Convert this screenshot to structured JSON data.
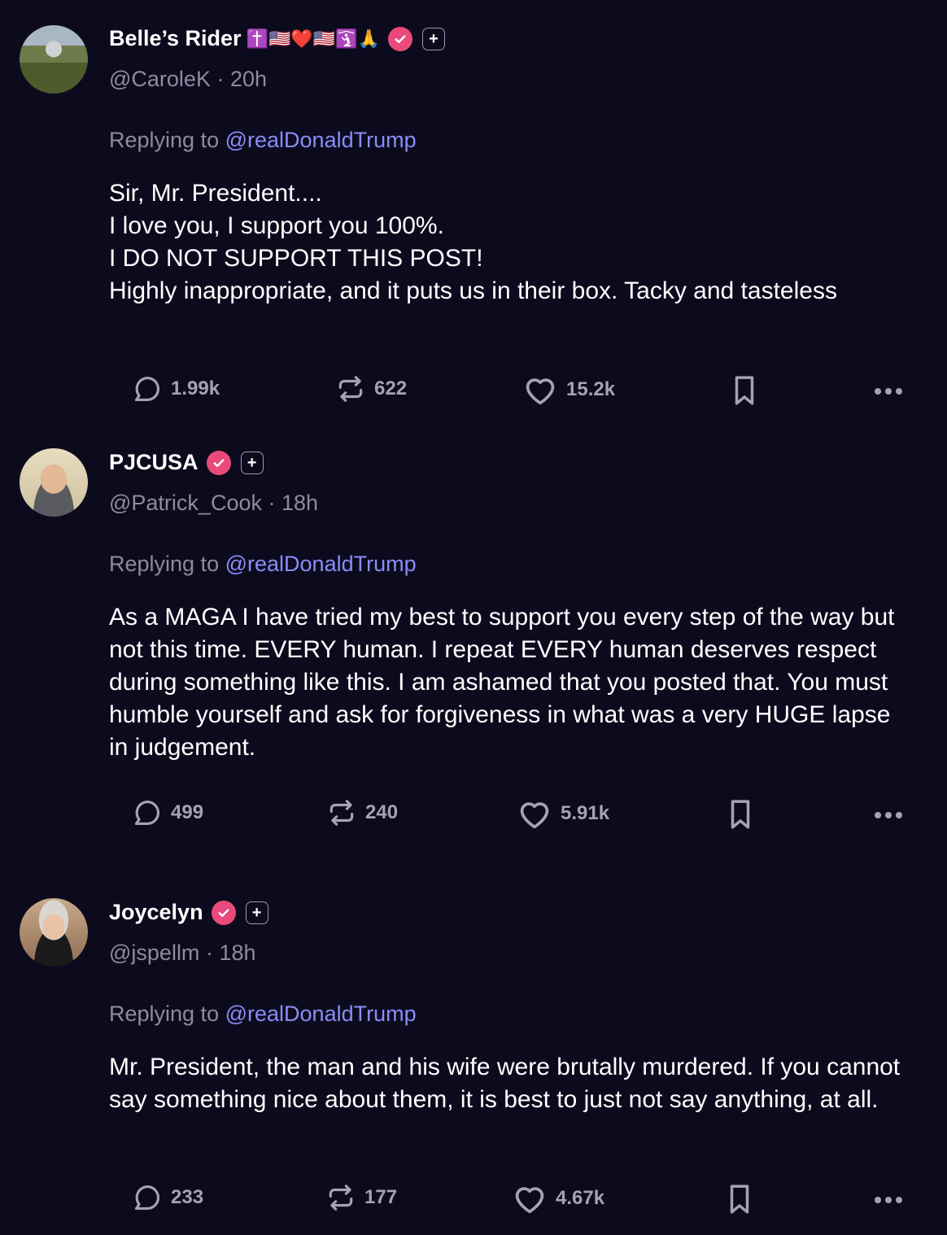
{
  "posts": [
    {
      "name": "Belle’s Rider",
      "emojis": "✝️🇺🇸❤️🇺🇸🛐🙏",
      "handle": "@CaroleK",
      "time": "20h",
      "replying_label": "Replying to",
      "replying_to": "@realDonaldTrump",
      "body": "Sir, Mr. President....\nI love you, I support you 100%.\nI DO NOT SUPPORT THIS POST!\nHighly inappropriate, and it puts us in their box. Tacky and tasteless",
      "replies": "1.99k",
      "reposts": "622",
      "likes": "15.2k"
    },
    {
      "name": "PJCUSA",
      "emojis": "",
      "handle": "@Patrick_Cook",
      "time": "18h",
      "replying_label": "Replying to",
      "replying_to": "@realDonaldTrump",
      "body": "As a MAGA I have tried my best to support you every step of the way but not this time.  EVERY human.  I repeat EVERY human deserves respect during something like this.  I am ashamed that you posted that. You must humble yourself and ask for forgiveness in what was a very HUGE lapse in judgement.",
      "replies": "499",
      "reposts": "240",
      "likes": "5.91k"
    },
    {
      "name": "Joycelyn",
      "emojis": "",
      "handle": "@jspellm",
      "time": "18h",
      "replying_label": "Replying to",
      "replying_to": "@realDonaldTrump",
      "body": "Mr. President, the man and his wife were brutally murdered.  If you cannot say something nice about them, it is best to just not say anything, at all.",
      "replies": "233",
      "reposts": "177",
      "likes": "4.67k"
    }
  ],
  "separator": "·",
  "plus_symbol": "+",
  "icons": {
    "reply": "reply-icon",
    "repost": "repost-icon",
    "like": "heart-icon",
    "bookmark": "bookmark-icon",
    "more": "more-icon",
    "verified": "verified-badge-icon",
    "plus": "plus-badge-icon"
  },
  "colors": {
    "background": "#0c0b1e",
    "mention": "#8a8cf6",
    "muted": "#8d8c9f",
    "verified": "#ea4a7b"
  }
}
